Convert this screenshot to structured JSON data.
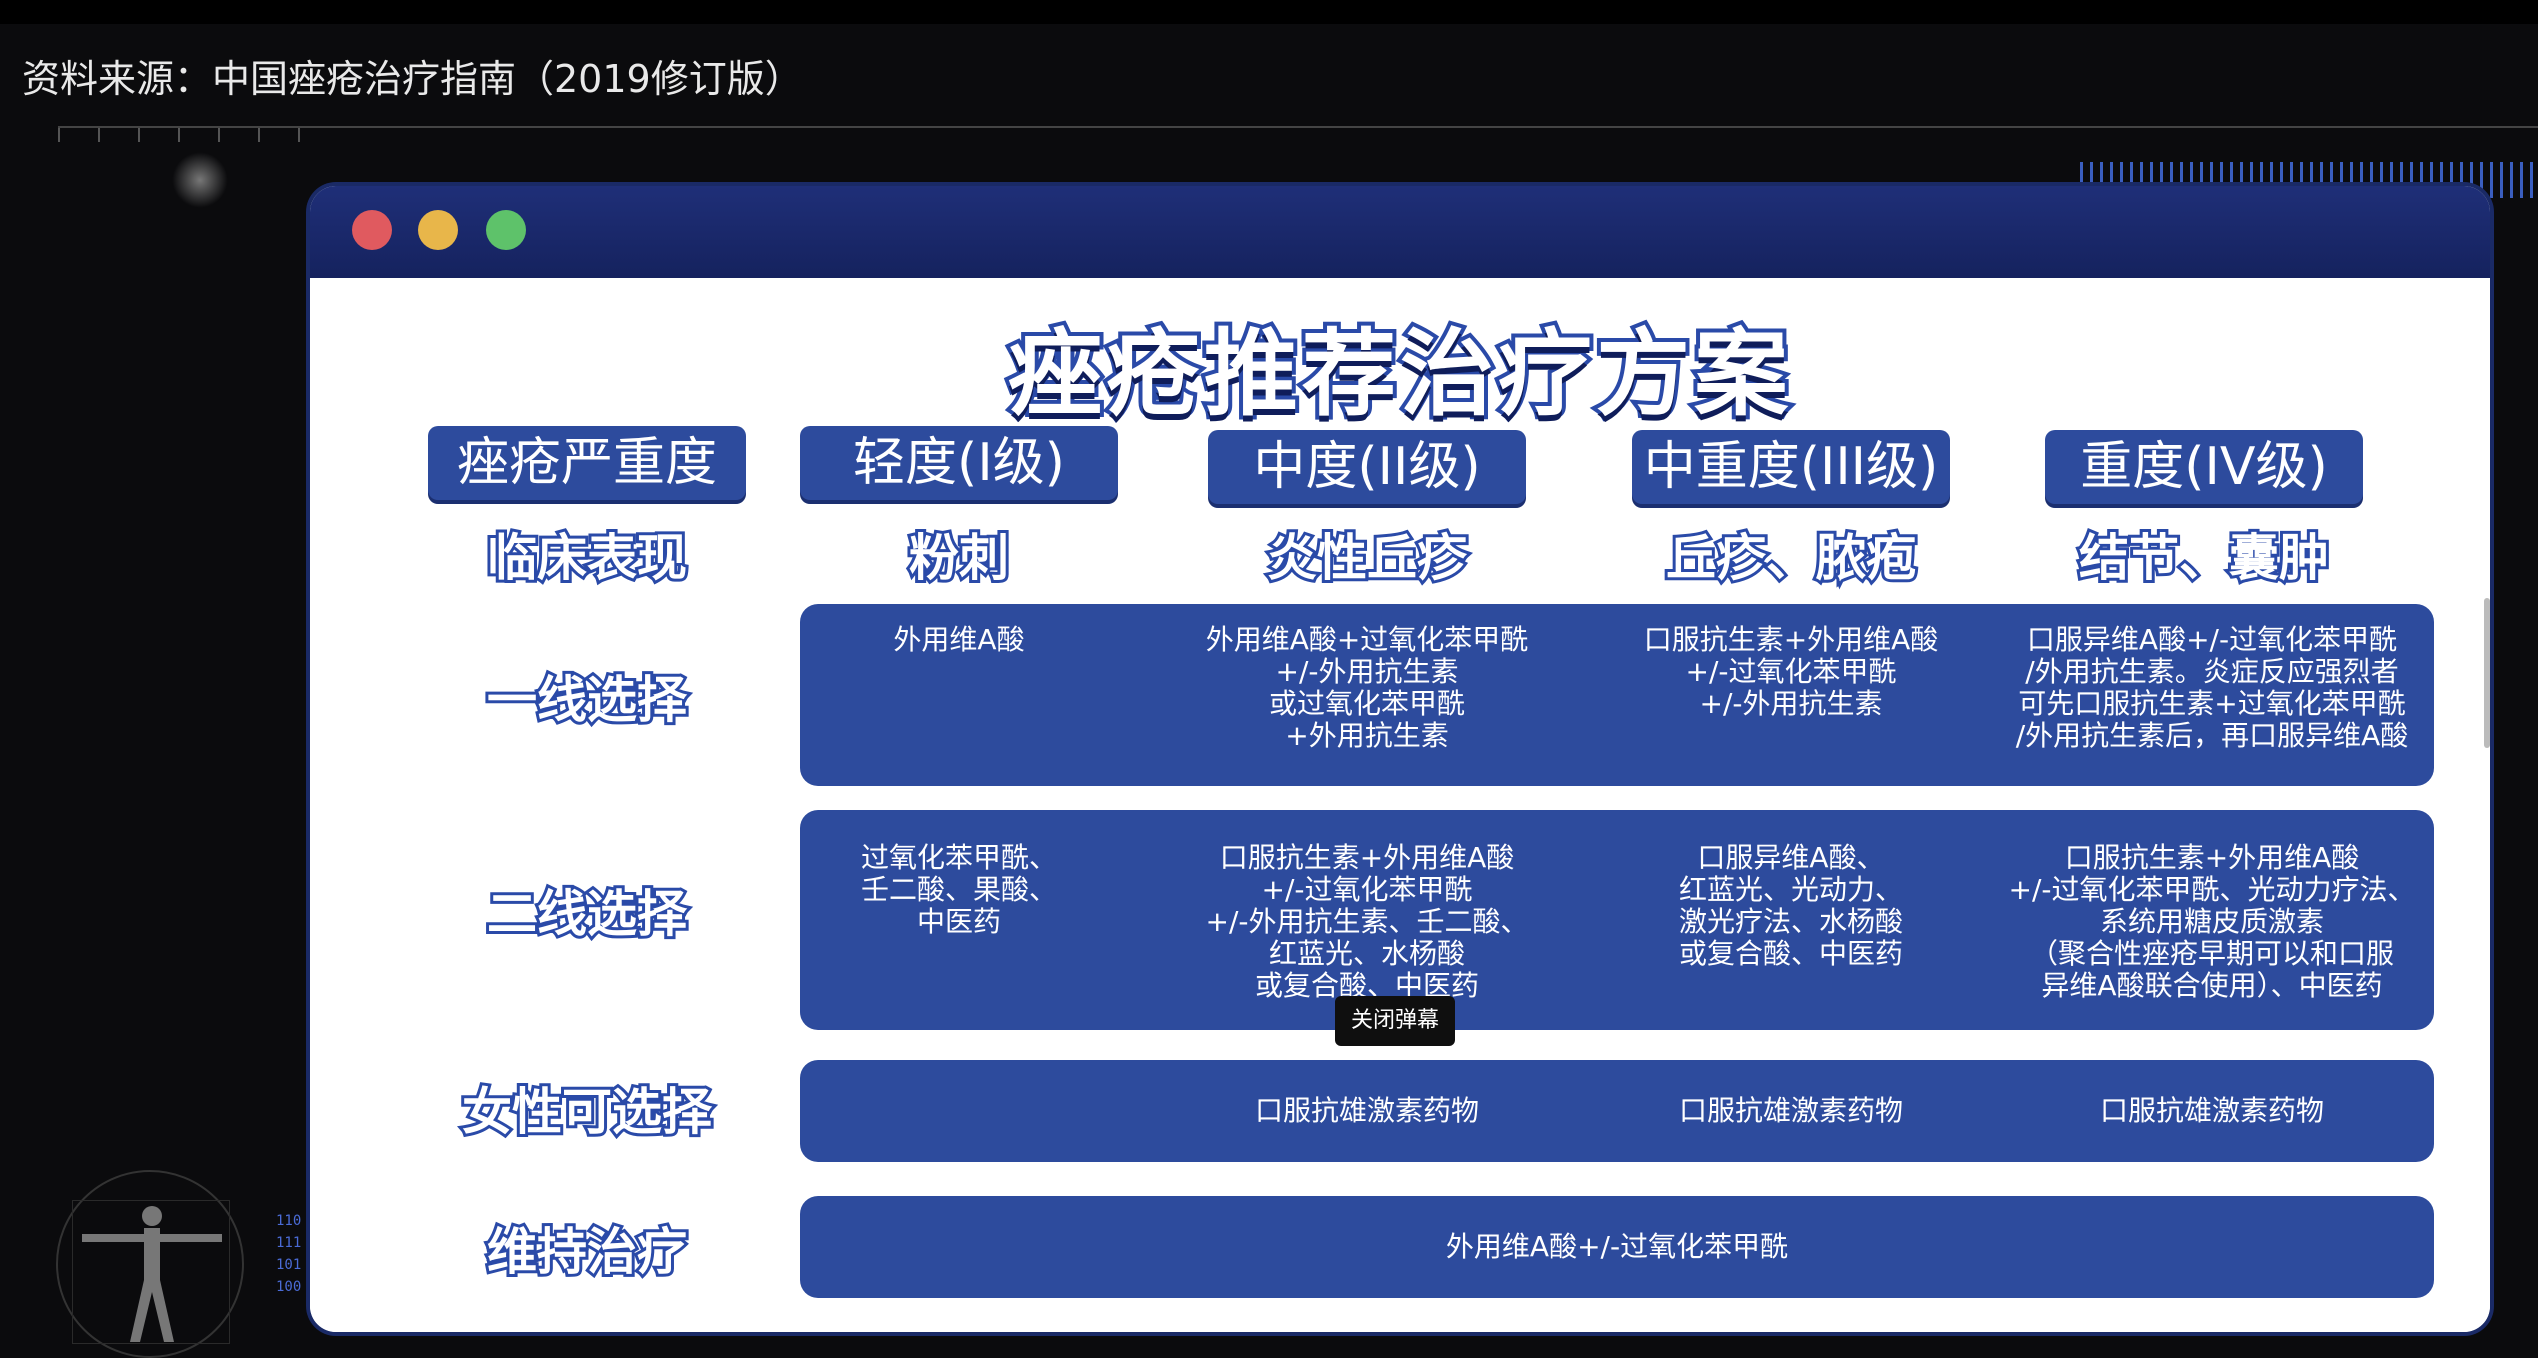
{
  "source_label": "资料来源：中国痤疮治疗指南（2019修订版）",
  "background": {
    "binary_digits": [
      "110",
      "111",
      "101",
      "100"
    ]
  },
  "window": {
    "title": "痤疮推荐治疗方案",
    "header_label": "痤疮严重度",
    "levels": [
      "轻度(I级)",
      "中度(II级)",
      "中重度(III级)",
      "重度(IV级)"
    ],
    "clinical": {
      "label": "临床表现",
      "values": [
        "粉刺",
        "炎性丘疹",
        "丘疹、脓疱",
        "结节、囊肿"
      ]
    },
    "first_line": {
      "label": "一线选择",
      "cells": [
        [
          "外用维A酸"
        ],
        [
          "外用维A酸+过氧化苯甲酰",
          "+/-外用抗生素",
          "或过氧化苯甲酰",
          "+外用抗生素"
        ],
        [
          "口服抗生素+外用维A酸",
          "+/-过氧化苯甲酰",
          "+/-外用抗生素"
        ],
        [
          "口服异维A酸+/-过氧化苯甲酰",
          "/外用抗生素。炎症反应强烈者",
          "可先口服抗生素+过氧化苯甲酰",
          "/外用抗生素后，再口服异维A酸"
        ]
      ]
    },
    "second_line": {
      "label": "二线选择",
      "cells": [
        [
          "过氧化苯甲酰、",
          "壬二酸、果酸、",
          "中医药"
        ],
        [
          "口服抗生素+外用维A酸",
          "+/-过氧化苯甲酰",
          "+/-外用抗生素、壬二酸、",
          "红蓝光、水杨酸",
          "或复合酸、中医药"
        ],
        [
          "口服异维A酸、",
          "红蓝光、光动力、",
          "激光疗法、水杨酸",
          "或复合酸、中医药"
        ],
        [
          "口服抗生素+外用维A酸",
          "+/-过氧化苯甲酰、光动力疗法、",
          "系统用糖皮质激素",
          "（聚合性痤疮早期可以和口服",
          "异维A酸联合使用）、中医药"
        ]
      ]
    },
    "female": {
      "label": "女性可选择",
      "cells": [
        "",
        "口服抗雄激素药物",
        "口服抗雄激素药物",
        "口服抗雄激素药物"
      ]
    },
    "maintenance": {
      "label": "维持治疗",
      "value": "外用维A酸+/-过氧化苯甲酰"
    },
    "tooltip": "关闭弹幕"
  }
}
